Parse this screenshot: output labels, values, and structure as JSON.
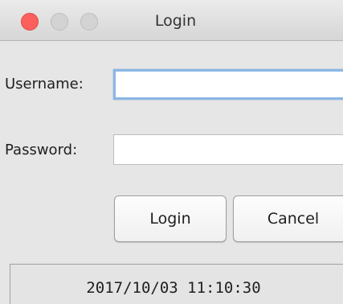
{
  "window": {
    "title": "Login"
  },
  "form": {
    "username_label": "Username:",
    "username_value": "",
    "password_label": "Password:",
    "password_value": ""
  },
  "buttons": {
    "login_label": "Login",
    "cancel_label": "Cancel"
  },
  "status": {
    "timestamp": "2017/10/03 11:10:30"
  },
  "colors": {
    "close_light": "#fc605c",
    "inactive_light": "#d3d3d3",
    "focus_ring": "#8ab6e4"
  },
  "icons": {
    "close": "close-traffic-light-icon",
    "minimize": "minimize-traffic-light-icon",
    "maximize": "maximize-traffic-light-icon"
  }
}
